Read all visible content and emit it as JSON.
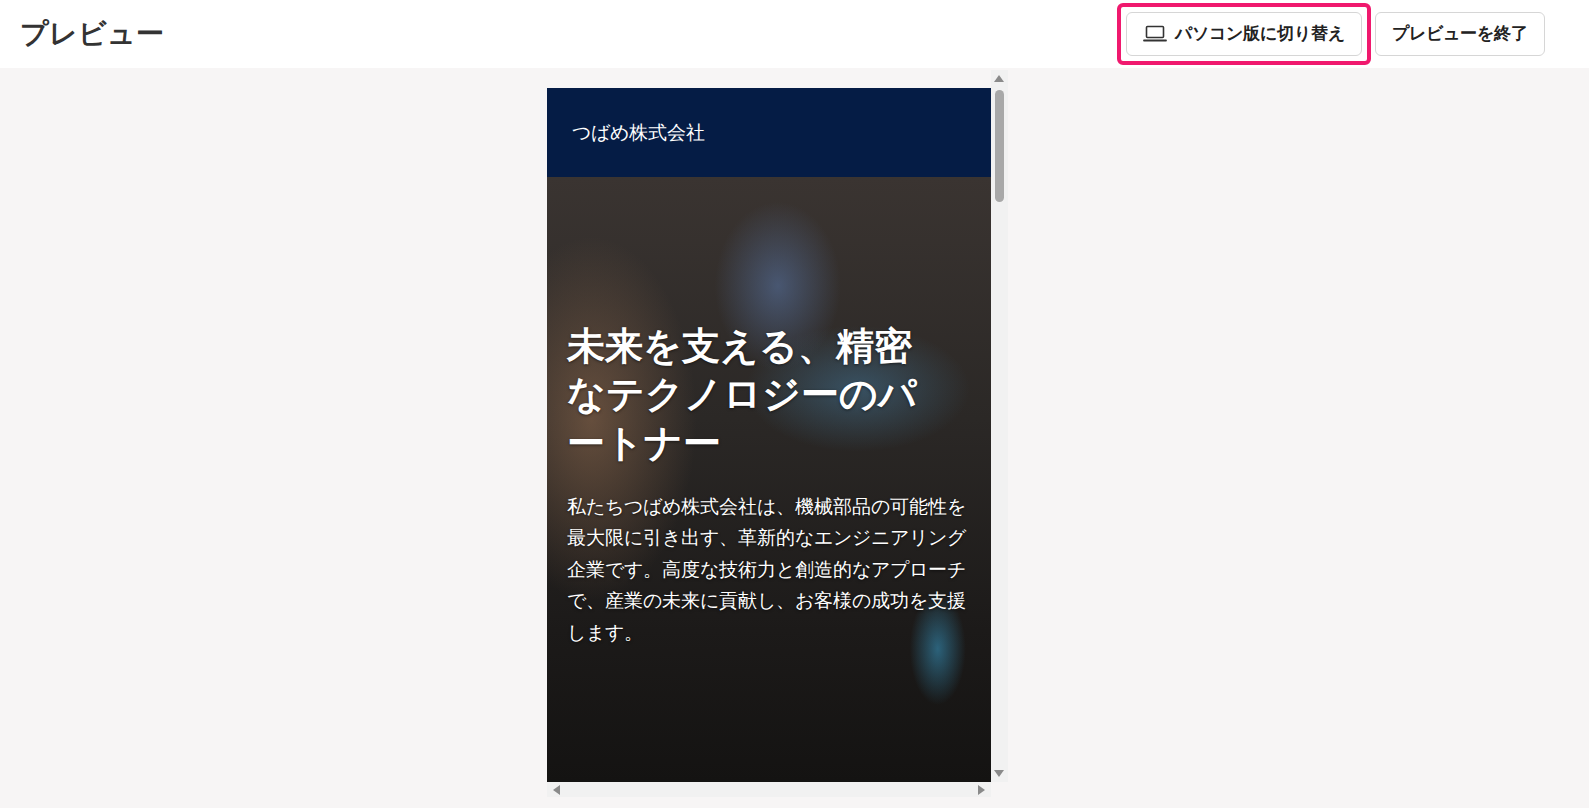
{
  "header": {
    "title": "プレビュー",
    "buttons": [
      {
        "label": "パソコン版に切り替え",
        "highlighted": true,
        "kind": "device"
      },
      {
        "label": "プレビューを終了",
        "highlighted": false,
        "kind": "plain"
      }
    ]
  },
  "site": {
    "company": "つばめ株式会社",
    "hero": {
      "heading": "未来を支える、精密なテクノロジーのパートナー",
      "body": "私たちつばめ株式会社は、機械部品の可能性を最大限に引き出す、革新的なエンジニアリング企業です。高度な技術力と創造的なアプローチで、産業の未来に貢献し、お客様の成功を支援します。"
    }
  }
}
